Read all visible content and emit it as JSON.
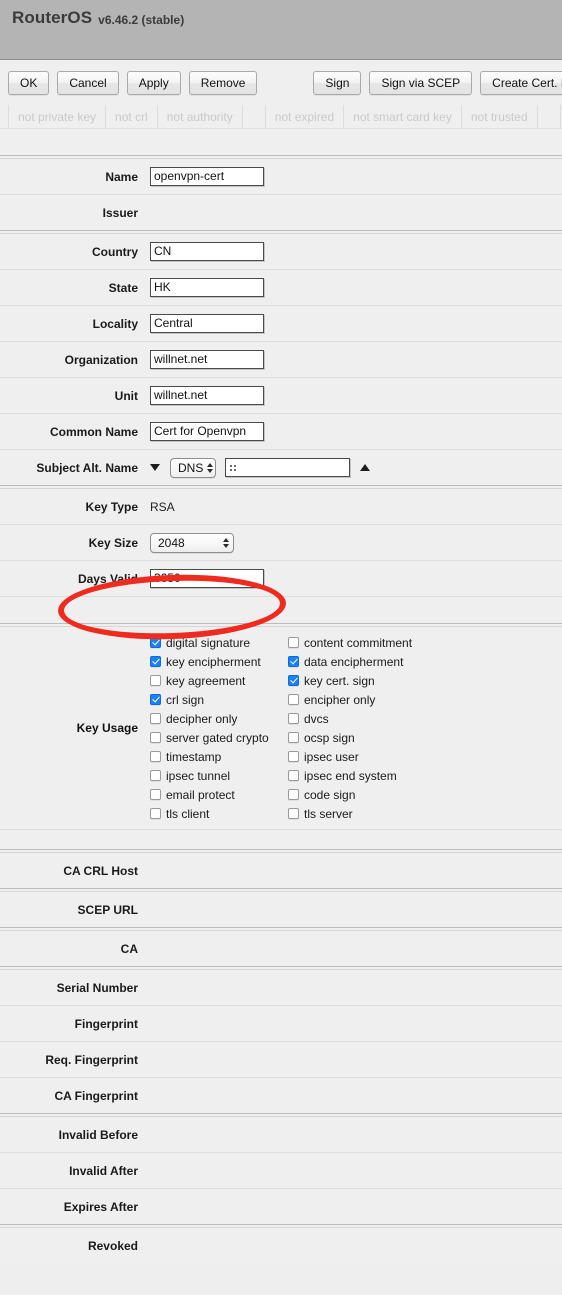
{
  "titlebar": {
    "app_name": "RouterOS",
    "version": "v6.46.2 (stable)"
  },
  "toolbar": {
    "buttons": [
      {
        "label": "OK",
        "name": "ok-button"
      },
      {
        "label": "Cancel",
        "name": "cancel-button"
      },
      {
        "label": "Apply",
        "name": "apply-button"
      },
      {
        "label": "Remove",
        "name": "remove-button"
      },
      {
        "label": "Sign",
        "name": "sign-button"
      },
      {
        "label": "Sign via SCEP",
        "name": "sign-via-scep-button"
      },
      {
        "label": "Create Cert. Request",
        "name": "create-cert-request-button"
      }
    ]
  },
  "status_flags": [
    {
      "label": "not private key"
    },
    {
      "label": "not crl"
    },
    {
      "label": "not authority"
    },
    {
      "label": ""
    },
    {
      "label": "not expired"
    },
    {
      "label": "not smart card key"
    },
    {
      "label": "not trusted"
    },
    {
      "label": ""
    }
  ],
  "form": {
    "name": {
      "label": "Name",
      "value": "openvpn-cert"
    },
    "issuer": {
      "label": "Issuer",
      "value": ""
    },
    "country": {
      "label": "Country",
      "value": "CN"
    },
    "state": {
      "label": "State",
      "value": "HK"
    },
    "locality": {
      "label": "Locality",
      "value": "Central"
    },
    "organization": {
      "label": "Organization",
      "value": "willnet.net"
    },
    "unit": {
      "label": "Unit",
      "value": "willnet.net"
    },
    "common_name": {
      "label": "Common Name",
      "value": "Cert for Openvpn"
    },
    "subject_alt_name": {
      "label": "Subject Alt. Name",
      "type_value": "DNS",
      "value": ""
    },
    "key_type": {
      "label": "Key Type",
      "value": "RSA"
    },
    "key_size": {
      "label": "Key Size",
      "value": "2048"
    },
    "days_valid": {
      "label": "Days Valid",
      "value": "3650"
    }
  },
  "key_usage": {
    "label": "Key Usage",
    "left": [
      {
        "label": "digital signature",
        "checked": true
      },
      {
        "label": "key encipherment",
        "checked": true
      },
      {
        "label": "key agreement",
        "checked": false
      },
      {
        "label": "crl sign",
        "checked": true
      },
      {
        "label": "decipher only",
        "checked": false
      },
      {
        "label": "server gated crypto",
        "checked": false
      },
      {
        "label": "timestamp",
        "checked": false
      },
      {
        "label": "ipsec tunnel",
        "checked": false
      },
      {
        "label": "email protect",
        "checked": false
      },
      {
        "label": "tls client",
        "checked": false
      }
    ],
    "right": [
      {
        "label": "content commitment",
        "checked": false
      },
      {
        "label": "data encipherment",
        "checked": true
      },
      {
        "label": "key cert. sign",
        "checked": true
      },
      {
        "label": "encipher only",
        "checked": false
      },
      {
        "label": "dvcs",
        "checked": false
      },
      {
        "label": "ocsp sign",
        "checked": false
      },
      {
        "label": "ipsec user",
        "checked": false
      },
      {
        "label": "ipsec end system",
        "checked": false
      },
      {
        "label": "code sign",
        "checked": false
      },
      {
        "label": "tls server",
        "checked": false
      }
    ]
  },
  "readonly_rows": [
    {
      "label": "CA CRL Host",
      "value": "",
      "group_break": true
    },
    {
      "label": "SCEP URL",
      "value": "",
      "group_break": true
    },
    {
      "label": "CA",
      "value": "",
      "group_break": true
    },
    {
      "label": "Serial Number",
      "value": "",
      "group_break": true
    },
    {
      "label": "Fingerprint",
      "value": "",
      "group_break": false
    },
    {
      "label": "Req. Fingerprint",
      "value": "",
      "group_break": false
    },
    {
      "label": "CA Fingerprint",
      "value": "",
      "group_break": false
    },
    {
      "label": "Invalid Before",
      "value": "",
      "group_break": true
    },
    {
      "label": "Invalid After",
      "value": "",
      "group_break": false
    },
    {
      "label": "Expires After",
      "value": "",
      "group_break": false
    },
    {
      "label": "Revoked",
      "value": "",
      "group_break": true
    }
  ],
  "annotation": {
    "name": "days-valid-highlight",
    "color": "#ef2b20",
    "shape": "ellipse"
  }
}
